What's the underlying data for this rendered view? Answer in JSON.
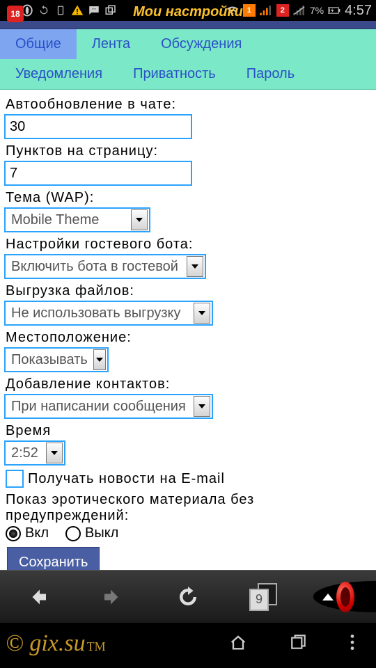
{
  "statusbar": {
    "battery_pct": "7%",
    "time": "4:57",
    "sim1": "1",
    "sim2": "2"
  },
  "header": {
    "title": "Мои настройки"
  },
  "tabs": {
    "row1": [
      "Общие",
      "Лента",
      "Обсуждения"
    ],
    "row2": [
      "Уведомления",
      "Приватность",
      "Пароль"
    ],
    "active_index": 0
  },
  "form": {
    "chat_autorefresh_label": "Автообновление в чате:",
    "chat_autorefresh_value": "30",
    "items_per_page_label": "Пунктов на страницу:",
    "items_per_page_value": "7",
    "theme_label": "Тема (WAP):",
    "theme_value": "Mobile Theme",
    "guest_bot_label": "Настройки гостевого бота:",
    "guest_bot_value": "Включить бота в гостевой",
    "upload_label": "Выгрузка файлов:",
    "upload_value": "Не использовать выгрузку",
    "location_label": "Местоположение:",
    "location_value": "Показывать",
    "contacts_label": "Добавление контактов:",
    "contacts_value": "При написании сообщения",
    "time_label": "Время",
    "time_value": "2:52",
    "news_email_label": "Получать новости на E-mail",
    "erotic_label": "Показ эротического материала без предупреждений:",
    "erotic_on": "Вкл",
    "erotic_off": "Выкл",
    "save": "Сохранить"
  },
  "browser": {
    "tab_count": "9"
  },
  "brand": {
    "copyright": "©",
    "name": "gix.su",
    "tm": "TM"
  }
}
